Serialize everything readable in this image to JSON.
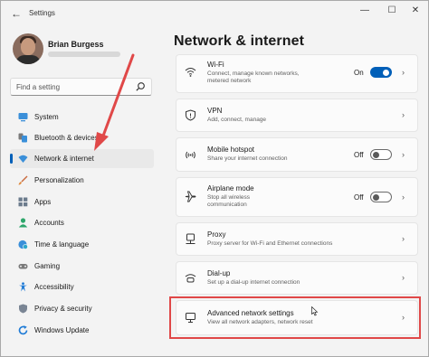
{
  "window": {
    "title": "Settings",
    "back_glyph": "←",
    "min_glyph": "—",
    "max_glyph": "☐",
    "close_glyph": "✕"
  },
  "profile": {
    "name": "Brian Burgess"
  },
  "search": {
    "placeholder": "Find a setting",
    "icon": "search-icon"
  },
  "nav": {
    "items": [
      {
        "label": "System",
        "icon": "monitor-icon",
        "selected": false
      },
      {
        "label": "Bluetooth & devices",
        "icon": "bluetooth-icon",
        "selected": false
      },
      {
        "label": "Network & internet",
        "icon": "wifi-icon",
        "selected": true
      },
      {
        "label": "Personalization",
        "icon": "brush-icon",
        "selected": false
      },
      {
        "label": "Apps",
        "icon": "apps-icon",
        "selected": false
      },
      {
        "label": "Accounts",
        "icon": "person-icon",
        "selected": false
      },
      {
        "label": "Time & language",
        "icon": "globe-clock-icon",
        "selected": false
      },
      {
        "label": "Gaming",
        "icon": "gamepad-icon",
        "selected": false
      },
      {
        "label": "Accessibility",
        "icon": "accessibility-icon",
        "selected": false
      },
      {
        "label": "Privacy & security",
        "icon": "shield-icon",
        "selected": false
      },
      {
        "label": "Windows Update",
        "icon": "update-icon",
        "selected": false
      }
    ]
  },
  "main": {
    "title": "Network & internet",
    "cards": [
      {
        "title": "Wi-Fi",
        "subtitle": "Connect, manage known networks, metered network",
        "icon": "wifi-icon",
        "toggle": "On",
        "toggle_on": true
      },
      {
        "title": "VPN",
        "subtitle": "Add, connect, manage",
        "icon": "vpn-shield-icon"
      },
      {
        "title": "Mobile hotspot",
        "subtitle": "Share your internet connection",
        "icon": "hotspot-icon",
        "toggle": "Off",
        "toggle_on": false
      },
      {
        "title": "Airplane mode",
        "subtitle": "Stop all wireless communication",
        "icon": "airplane-icon",
        "toggle": "Off",
        "toggle_on": false
      },
      {
        "title": "Proxy",
        "subtitle": "Proxy server for Wi-Fi and Ethernet connections",
        "icon": "proxy-icon"
      },
      {
        "title": "Dial-up",
        "subtitle": "Set up a dial-up internet connection",
        "icon": "dialup-icon"
      },
      {
        "title": "Advanced network settings",
        "subtitle": "View all network adapters, network reset",
        "icon": "network-adapter-icon"
      }
    ]
  },
  "colors": {
    "accent": "#005fb8",
    "annotation": "#e04848"
  }
}
